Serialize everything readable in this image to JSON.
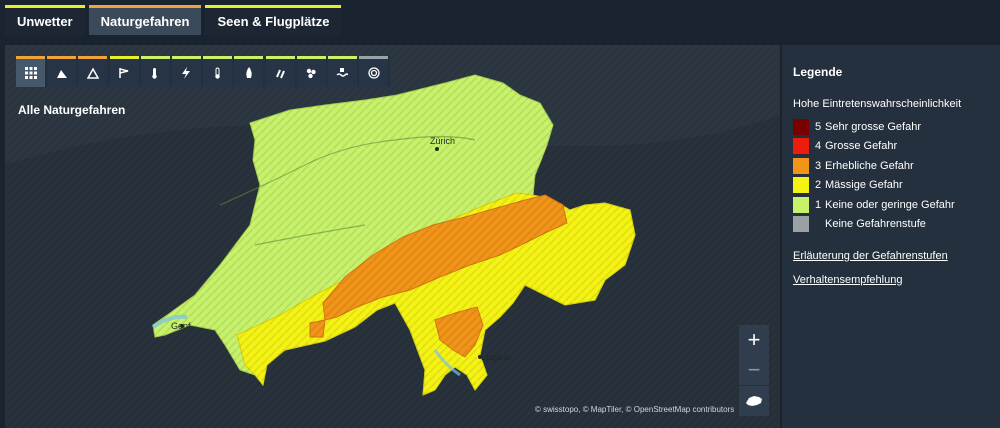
{
  "tabs": [
    {
      "label": "Unwetter",
      "active": false
    },
    {
      "label": "Naturgefahren",
      "active": true
    },
    {
      "label": "Seen & Flugplätze",
      "active": false
    }
  ],
  "hazards": [
    {
      "icon": "all-hazards-grid-icon",
      "level_color": "#f0a33a",
      "active": true
    },
    {
      "icon": "avalanche-icon",
      "level_color": "#f0a33a"
    },
    {
      "icon": "landslide-icon",
      "level_color": "#f0a33a"
    },
    {
      "icon": "wind-icon",
      "level_color": "#e5ef2a"
    },
    {
      "icon": "heat-icon",
      "level_color": "#c7f26a"
    },
    {
      "icon": "thunderstorm-icon",
      "level_color": "#c7f26a"
    },
    {
      "icon": "cold-icon",
      "level_color": "#c7f26a"
    },
    {
      "icon": "forest-fire-icon",
      "level_color": "#c7f26a"
    },
    {
      "icon": "rain-icon",
      "level_color": "#c7f26a"
    },
    {
      "icon": "snow-icon",
      "level_color": "#c7f26a"
    },
    {
      "icon": "flood-icon",
      "level_color": "#c7f26a"
    },
    {
      "icon": "earthquake-icon",
      "level_color": "#9aa3ab"
    }
  ],
  "map": {
    "title": "Alle Naturgefahren",
    "cities": {
      "zurich": "Zürich",
      "genf": "Genf",
      "lugano": "Lugano"
    },
    "attribution": "© swisstopo, © MapTiler, © OpenStreetMap contributors",
    "controls": {
      "zoom_in": "+",
      "zoom_out": "−"
    }
  },
  "legend": {
    "title": "Legende",
    "subtitle": "Hohe Eintretenswahrscheinlichkeit",
    "levels": [
      {
        "num": "5",
        "label": "Sehr grosse Gefahr",
        "color": "#7a0000"
      },
      {
        "num": "4",
        "label": "Grosse Gefahr",
        "color": "#ee1c0c"
      },
      {
        "num": "3",
        "label": "Erhebliche Gefahr",
        "color": "#f29418"
      },
      {
        "num": "2",
        "label": "Mässige Gefahr",
        "color": "#f5f314"
      },
      {
        "num": "1",
        "label": "Keine oder geringe Gefahr",
        "color": "#c7f26a"
      },
      {
        "num": "",
        "label": "Keine Gefahrenstufe",
        "color": "#9ba0a5"
      }
    ],
    "links": [
      "Erläuterung der Gefahrenstufen",
      "Verhaltensempfehlung"
    ]
  }
}
